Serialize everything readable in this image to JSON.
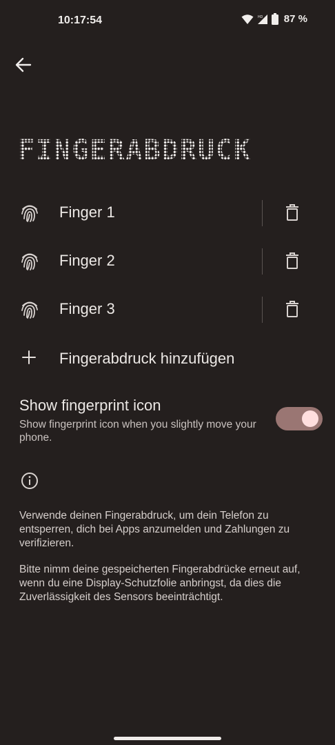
{
  "status_bar": {
    "time": "10:17:54",
    "battery": "87 %"
  },
  "page": {
    "title": "FINGERABDRUCK"
  },
  "fingerprints": [
    {
      "label": "Finger 1"
    },
    {
      "label": "Finger 2"
    },
    {
      "label": "Finger 3"
    }
  ],
  "add_fingerprint": {
    "label": "Fingerabdruck hinzufügen"
  },
  "show_icon": {
    "title": "Show fingerprint icon",
    "subtitle": "Show fingerprint icon when you slightly move your phone.",
    "enabled": true
  },
  "info": {
    "paragraph1": "Verwende deinen Fingerabdruck, um dein Telefon zu entsperren, dich bei Apps anzumelden und Zahlungen zu verifizieren.",
    "paragraph2": "Bitte nimm deine gespeicherten Fingerabdrücke erneut auf, wenn du eine Display-Schutzfolie anbringst, da dies die Zuverlässigkeit des Sensors beeinträchtigt."
  },
  "colors": {
    "background": "#241f1e",
    "switch_track": "#9a7673",
    "switch_knob": "#ffdede"
  },
  "icons": [
    "back-arrow-icon",
    "fingerprint-icon",
    "trash-icon",
    "plus-icon",
    "info-icon",
    "wifi-icon",
    "signal-icon",
    "battery-icon"
  ]
}
